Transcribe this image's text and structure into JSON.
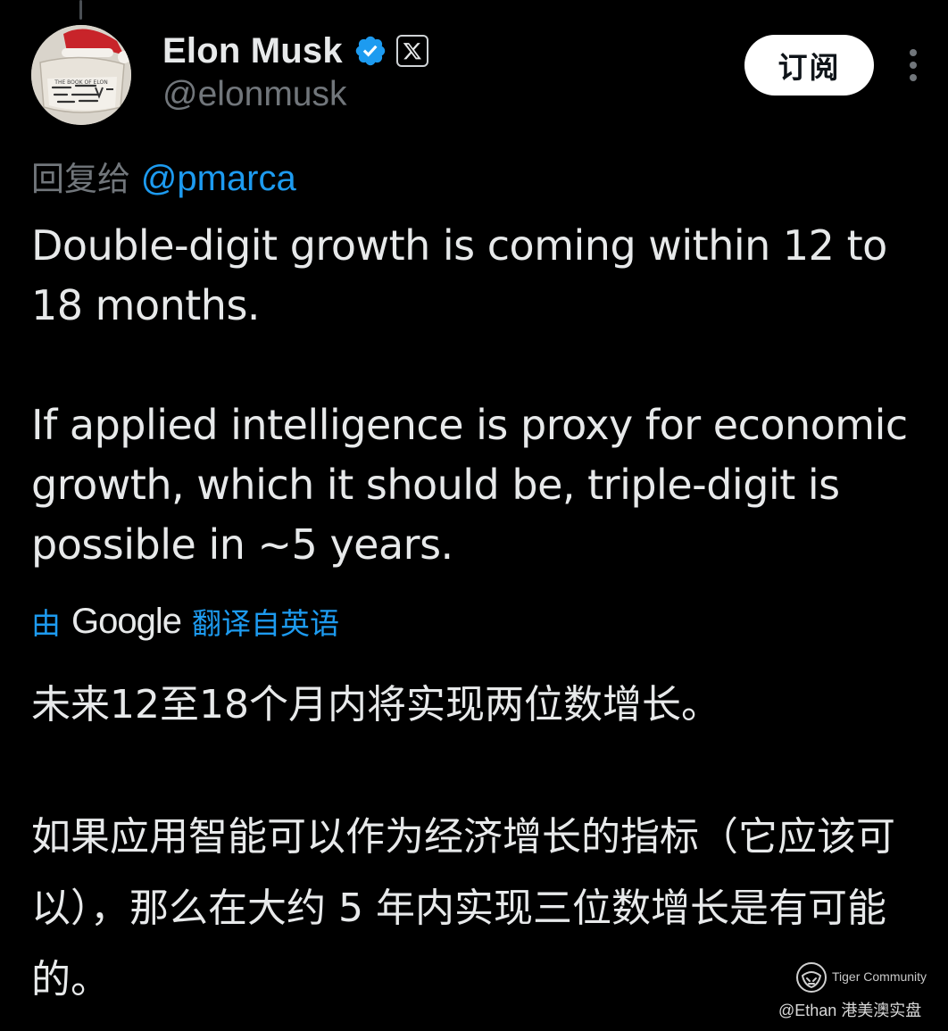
{
  "author": {
    "display_name": "Elon Musk",
    "handle": "@elonmusk",
    "verified_icon": "verified-badge-icon",
    "affiliate_icon": "x-logo-icon",
    "avatar_text": "THE BOOK OF ELON"
  },
  "header": {
    "subscribe_label": "订阅",
    "more_icon": "more-vertical-icon"
  },
  "reply": {
    "prefix": "回复给 ",
    "mention": "@pmarca"
  },
  "tweet": {
    "paragraphs": [
      "Double-digit growth is coming within 12 to 18 months.",
      "If applied intelligence is proxy for economic growth, which it should be, triple-digit is possible in ~5 years."
    ]
  },
  "translation": {
    "prefix": "由",
    "provider": "Google",
    "suffix": "翻译自英语",
    "paragraphs": [
      "未来12至18个月内将实现两位数增长。",
      "如果应用智能可以作为经济增长的指标（它应该可以），那么在大约 5 年内实现三位数增长是有可能的。"
    ]
  },
  "watermark": {
    "brand": "Tiger Community",
    "author": "@Ethan 港美澳实盘"
  },
  "colors": {
    "background": "#000000",
    "text": "#e7e9ea",
    "secondary": "#71767b",
    "link": "#1d9bf0",
    "verified": "#1d9bf0"
  }
}
